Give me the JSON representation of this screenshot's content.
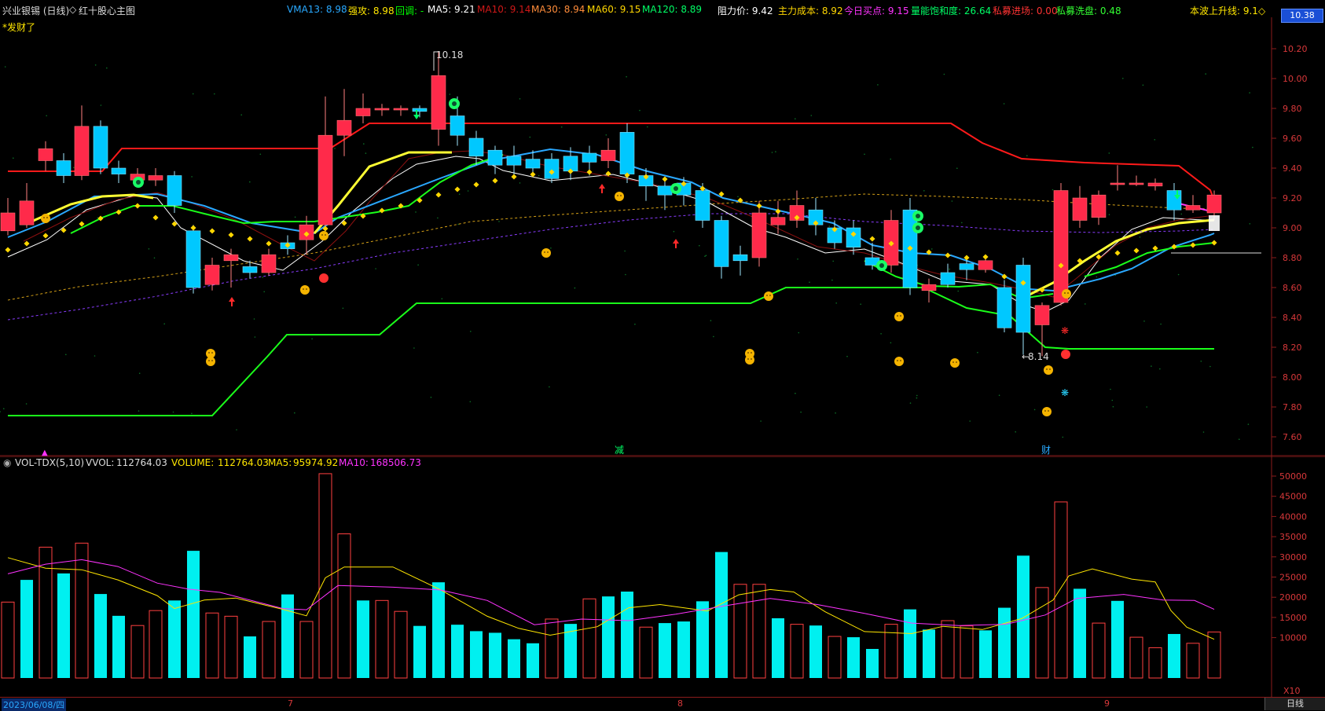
{
  "header": {
    "stock_title": "兴业银锡 (日线)",
    "indicator_title": "红十股心主图",
    "items": [
      {
        "label": "VMA13:",
        "value": "8.98",
        "color": "#29a9ff"
      },
      {
        "label": "强攻:",
        "value": "8.98",
        "color": "#ffe600"
      },
      {
        "label": "回调:",
        "value": "-",
        "color": "#00ff00"
      },
      {
        "label": "MA5:",
        "value": "9.21",
        "color": "#ffffff"
      },
      {
        "label": "MA10:",
        "value": "9.14",
        "color": "#d01818"
      },
      {
        "label": "MA30:",
        "value": "8.94",
        "color": "#ff8c3a"
      },
      {
        "label": "MA60:",
        "value": "9.15",
        "color": "#ffd700"
      },
      {
        "label": "MA120:",
        "value": "8.89",
        "color": "#00ff66"
      },
      {
        "label": "阻力价:",
        "value": "9.42",
        "color": "#ffffff"
      },
      {
        "label": "主力成本:",
        "value": "8.92",
        "color": "#ffd700"
      },
      {
        "label": "今日买点:",
        "value": "9.15",
        "color": "#ff33ff"
      },
      {
        "label": "量能饱和度:",
        "value": "26.64",
        "color": "#00ff66"
      },
      {
        "label": "私募进场:",
        "value": "0.00",
        "color": "#ff3333"
      },
      {
        "label": "私募洗盘:",
        "value": "0.48",
        "color": "#33ff33"
      },
      {
        "label": "本波上升线:",
        "value": "9.1◇",
        "color": "#ffe600"
      }
    ],
    "subtitle": "*发财了",
    "current_price": "10.38"
  },
  "price_axis": [
    "10.20",
    "10.00",
    "9.80",
    "9.60",
    "9.40",
    "9.20",
    "9.00",
    "8.80",
    "8.60",
    "8.40",
    "8.20",
    "8.00",
    "7.80",
    "7.60"
  ],
  "annotations": {
    "high": "10.18",
    "low": "8.14",
    "mark_jian": "减",
    "mark_cai": "财"
  },
  "volume": {
    "title": "VOL-TDX(5,10)",
    "vvol_label": "VVOL:",
    "vvol": "112764.03",
    "volume_label": "VOLUME:",
    "volume_value": "112764.03",
    "ma5_label": "MA5:",
    "ma5": "95974.92",
    "ma10_label": "MA10:",
    "ma10": "168506.73",
    "axis": [
      "50000",
      "45000",
      "40000",
      "35000",
      "30000",
      "25000",
      "20000",
      "15000",
      "10000"
    ],
    "unit": "X10"
  },
  "bottom": {
    "date": "2023/06/08/四",
    "m7": "7",
    "m8": "8",
    "m9": "9",
    "timeframe": "日线"
  },
  "colors": {
    "up": "#ff2a2a",
    "down": "#00e5ff",
    "bg": "#000000",
    "grid": "#8b1c1c"
  }
}
